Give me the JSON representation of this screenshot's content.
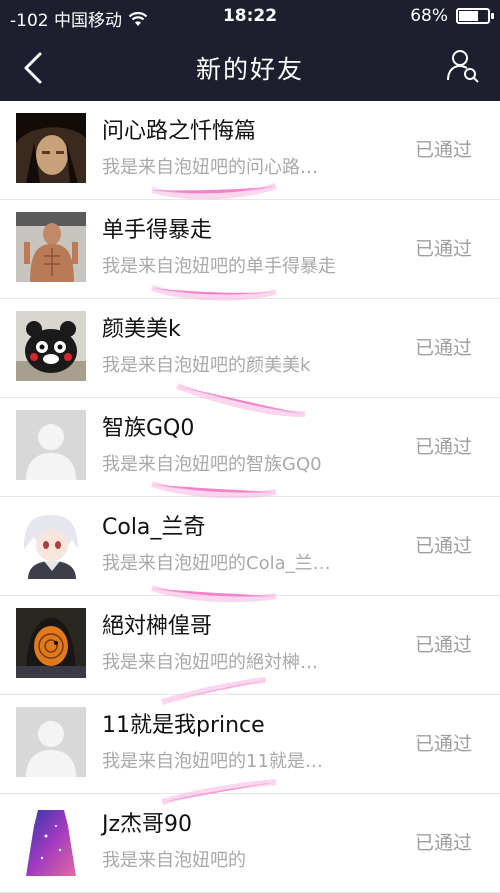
{
  "status_bar": {
    "carrier": "-102 中国移动",
    "time": "18:22",
    "battery": "68%",
    "battery_level": 0.68
  },
  "nav": {
    "title": "新的好友"
  },
  "friends": [
    {
      "name": "问心路之忏悔篇",
      "message": "我是来自泡妞吧的问心路…",
      "status": "已通过",
      "avatar": "warrior-avatar"
    },
    {
      "name": "单手得暴走",
      "message": "我是来自泡妞吧的单手得暴走",
      "status": "已通过",
      "avatar": "muscle-man-avatar"
    },
    {
      "name": "颜美美k",
      "message": "我是来自泡妞吧的颜美美k",
      "status": "已通过",
      "avatar": "kumamon-avatar"
    },
    {
      "name": "智族GQ0",
      "message": "我是来自泡妞吧的智族GQ0",
      "status": "已通过",
      "avatar": "default-avatar"
    },
    {
      "name": "Cola_兰奇",
      "message": "我是来自泡妞吧的Cola_兰…",
      "status": "已通过",
      "avatar": "anime-white-hair-avatar"
    },
    {
      "name": "絕対榊偟哥",
      "message": "我是来自泡妞吧的絕対榊…",
      "status": "已通过",
      "avatar": "orange-mask-avatar"
    },
    {
      "name": "11就是我prince",
      "message": "我是来自泡妞吧的11就是…",
      "status": "已通过",
      "avatar": "default-avatar"
    },
    {
      "name": "Jz杰哥90",
      "message": "我是来自泡妞吧的",
      "status": "已通过",
      "avatar": "galaxy-dress-avatar"
    }
  ]
}
